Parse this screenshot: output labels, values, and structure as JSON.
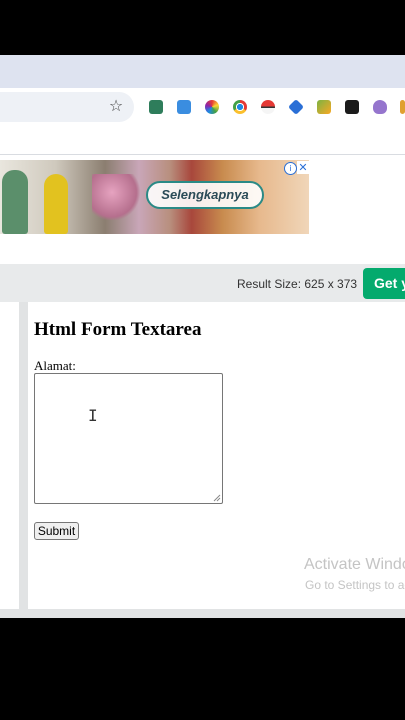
{
  "ad": {
    "cta_label": "Selengkapnya",
    "info_icon": "info-icon",
    "close_icon": "close-icon"
  },
  "extensions": [
    "screencast-icon",
    "translate-icon",
    "color-picker-icon",
    "chrome-icon",
    "pokeball-icon",
    "tag-icon",
    "arrow-icon",
    "dark-square-icon",
    "ghost-icon"
  ],
  "editor": {
    "result_size": "Result Size: 625 x 373",
    "get_label": "Get y"
  },
  "form": {
    "title": "Html Form Textarea",
    "label": "Alamat:",
    "textarea_value": "",
    "submit_label": "Submit"
  },
  "watermark": {
    "title": "Activate Windo",
    "subtitle": "Go to Settings to ac"
  },
  "colors": {
    "accent_green": "#04aa6d",
    "tab_strip": "#dee3f0"
  }
}
